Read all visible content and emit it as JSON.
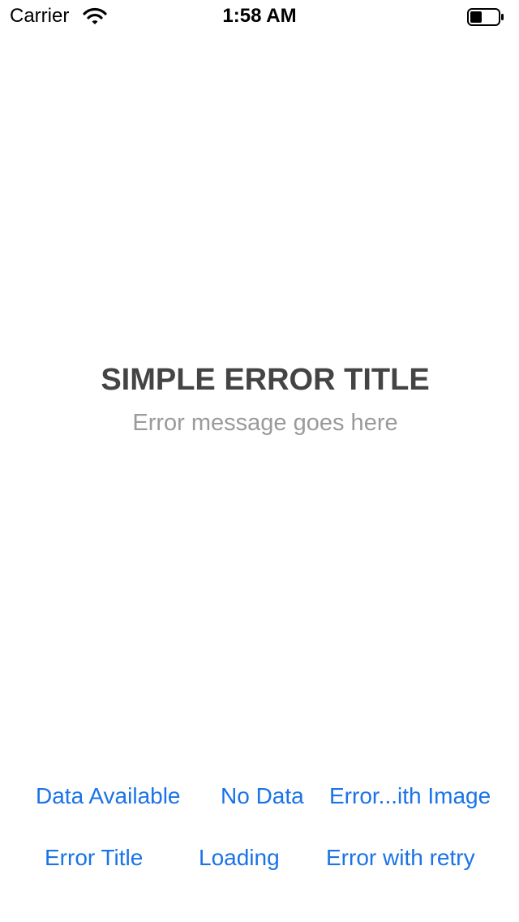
{
  "status_bar": {
    "carrier": "Carrier",
    "wifi_icon": "wifi-icon",
    "time": "1:58 AM",
    "battery_icon": "battery-icon",
    "battery_level": 0.4
  },
  "error": {
    "title": "SIMPLE ERROR TITLE",
    "message": "Error message goes here"
  },
  "buttons": {
    "data_available": "Data Available",
    "no_data": "No Data",
    "error_with_image": "Error...ith Image",
    "error_title": "Error Title",
    "loading": "Loading",
    "error_with_retry": "Error with retry"
  },
  "colors": {
    "accent": "#1a73e8",
    "title": "#444444",
    "message": "#9a9a9a",
    "background": "#ffffff"
  }
}
